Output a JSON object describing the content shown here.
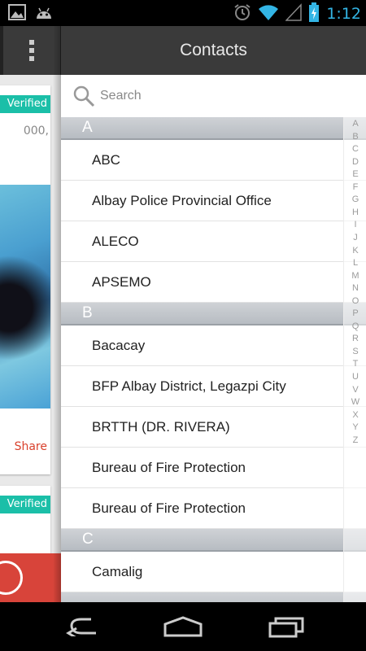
{
  "status_bar": {
    "time": "1:12",
    "icons": [
      "gallery-icon",
      "android-icon",
      "alarm-icon",
      "wifi-icon",
      "signal-icon",
      "battery-charging-icon"
    ],
    "accent": "#33b5e5"
  },
  "background_app": {
    "card1": {
      "badge": "Verified",
      "text": "000,",
      "action": "Share"
    },
    "card2": {
      "badge": "Verified"
    },
    "badge_color": "#1bbfa8",
    "fab_color": "#d8443a"
  },
  "contacts": {
    "title": "Contacts",
    "search": {
      "placeholder": "Search",
      "value": ""
    },
    "sections": [
      {
        "letter": "A",
        "items": [
          "ABC",
          "Albay Police Provincial Office",
          "ALECO",
          "APSEMO"
        ]
      },
      {
        "letter": "B",
        "items": [
          "Bacacay",
          "BFP Albay District, Legazpi City",
          "BRTTH (DR. RIVERA)",
          "Bureau of Fire Protection",
          "Bureau of Fire Protection"
        ]
      },
      {
        "letter": "C",
        "items": [
          "Camalig"
        ]
      }
    ],
    "index_letters": [
      "A",
      "B",
      "C",
      "D",
      "E",
      "F",
      "G",
      "H",
      "I",
      "J",
      "K",
      "L",
      "M",
      "N",
      "O",
      "P",
      "Q",
      "R",
      "S",
      "T",
      "U",
      "V",
      "W",
      "X",
      "Y",
      "Z"
    ]
  },
  "nav_bar": {
    "buttons": [
      "back-icon",
      "home-icon",
      "recents-icon"
    ]
  }
}
